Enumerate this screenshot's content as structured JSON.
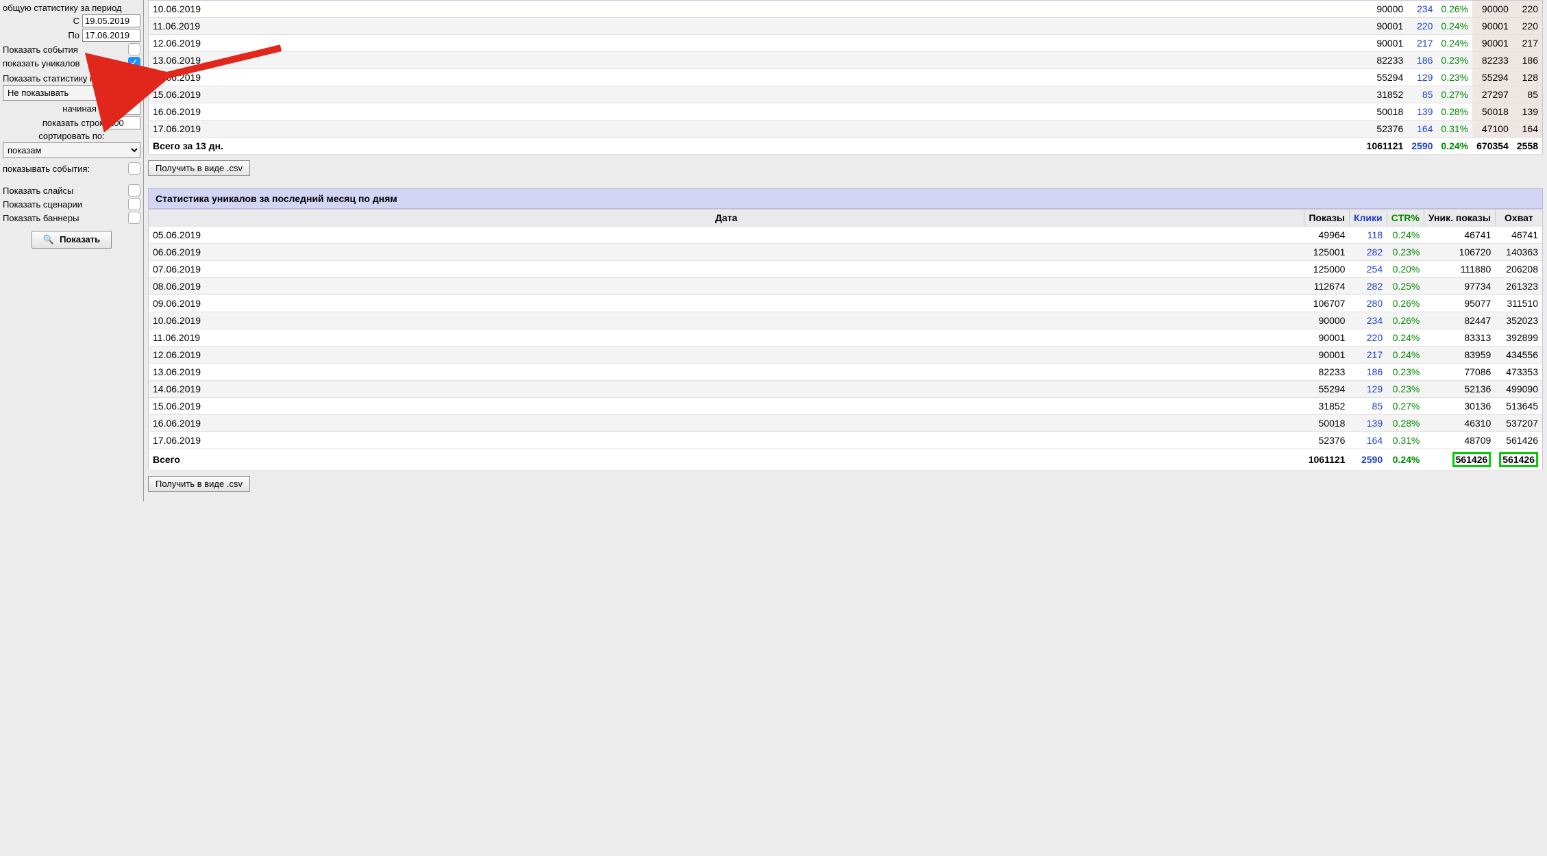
{
  "sidebar": {
    "period_label": "общую статистику за период",
    "from_label": "С",
    "from_value": "19.05.2019",
    "to_label": "По",
    "to_value": "17.06.2019",
    "show_events_label": "Показать события",
    "show_uniques_label": "показать уникалов",
    "sites_heading": "Показать статистику по сайтам:",
    "sites_select": "Не показывать",
    "starting_label": "начиная с",
    "starting_value": "0",
    "rows_label": "показать строк",
    "rows_value": "100",
    "sort_label": "сортировать по:",
    "sort_select": "показам",
    "show_events2_label": "показывать события:",
    "show_slices_label": "Показать слайсы",
    "show_scenarios_label": "Показать сценарии",
    "show_banners_label": "Показать баннеры",
    "show_btn": "Показать"
  },
  "csv_btn": "Получить в виде .csv",
  "table1": {
    "rows": [
      {
        "date": "10.06.2019",
        "shows": "90000",
        "clicks": "234",
        "ctr": "0.26%",
        "u1": "90000",
        "u2": "220"
      },
      {
        "date": "11.06.2019",
        "shows": "90001",
        "clicks": "220",
        "ctr": "0.24%",
        "u1": "90001",
        "u2": "220"
      },
      {
        "date": "12.06.2019",
        "shows": "90001",
        "clicks": "217",
        "ctr": "0.24%",
        "u1": "90001",
        "u2": "217"
      },
      {
        "date": "13.06.2019",
        "shows": "82233",
        "clicks": "186",
        "ctr": "0.23%",
        "u1": "82233",
        "u2": "186"
      },
      {
        "date": "14.06.2019",
        "shows": "55294",
        "clicks": "129",
        "ctr": "0.23%",
        "u1": "55294",
        "u2": "128"
      },
      {
        "date": "15.06.2019",
        "shows": "31852",
        "clicks": "85",
        "ctr": "0.27%",
        "u1": "27297",
        "u2": "85"
      },
      {
        "date": "16.06.2019",
        "shows": "50018",
        "clicks": "139",
        "ctr": "0.28%",
        "u1": "50018",
        "u2": "139"
      },
      {
        "date": "17.06.2019",
        "shows": "52376",
        "clicks": "164",
        "ctr": "0.31%",
        "u1": "47100",
        "u2": "164"
      }
    ],
    "totals": {
      "date": "Всего за 13 дн.",
      "shows": "1061121",
      "clicks": "2590",
      "ctr": "0.24%",
      "u1": "670354",
      "u2": "2558"
    }
  },
  "section2_title": "Статистика уникалов за последний месяц по дням",
  "table2": {
    "headers": {
      "date": "Дата",
      "shows": "Показы",
      "clicks": "Клики",
      "ctr": "CTR%",
      "ushow": "Уник. показы",
      "reach": "Охват"
    },
    "rows": [
      {
        "date": "05.06.2019",
        "shows": "49964",
        "clicks": "118",
        "ctr": "0.24%",
        "ushow": "46741",
        "reach": "46741"
      },
      {
        "date": "06.06.2019",
        "shows": "125001",
        "clicks": "282",
        "ctr": "0.23%",
        "ushow": "106720",
        "reach": "140363"
      },
      {
        "date": "07.06.2019",
        "shows": "125000",
        "clicks": "254",
        "ctr": "0.20%",
        "ushow": "111880",
        "reach": "206208"
      },
      {
        "date": "08.06.2019",
        "shows": "112674",
        "clicks": "282",
        "ctr": "0.25%",
        "ushow": "97734",
        "reach": "261323"
      },
      {
        "date": "09.06.2019",
        "shows": "106707",
        "clicks": "280",
        "ctr": "0.26%",
        "ushow": "95077",
        "reach": "311510"
      },
      {
        "date": "10.06.2019",
        "shows": "90000",
        "clicks": "234",
        "ctr": "0.26%",
        "ushow": "82447",
        "reach": "352023"
      },
      {
        "date": "11.06.2019",
        "shows": "90001",
        "clicks": "220",
        "ctr": "0.24%",
        "ushow": "83313",
        "reach": "392899"
      },
      {
        "date": "12.06.2019",
        "shows": "90001",
        "clicks": "217",
        "ctr": "0.24%",
        "ushow": "83959",
        "reach": "434556"
      },
      {
        "date": "13.06.2019",
        "shows": "82233",
        "clicks": "186",
        "ctr": "0.23%",
        "ushow": "77086",
        "reach": "473353"
      },
      {
        "date": "14.06.2019",
        "shows": "55294",
        "clicks": "129",
        "ctr": "0.23%",
        "ushow": "52136",
        "reach": "499090"
      },
      {
        "date": "15.06.2019",
        "shows": "31852",
        "clicks": "85",
        "ctr": "0.27%",
        "ushow": "30136",
        "reach": "513645"
      },
      {
        "date": "16.06.2019",
        "shows": "50018",
        "clicks": "139",
        "ctr": "0.28%",
        "ushow": "46310",
        "reach": "537207"
      },
      {
        "date": "17.06.2019",
        "shows": "52376",
        "clicks": "164",
        "ctr": "0.31%",
        "ushow": "48709",
        "reach": "561426"
      }
    ],
    "totals": {
      "date": "Всего",
      "shows": "1061121",
      "clicks": "2590",
      "ctr": "0.24%",
      "ushow": "561426",
      "reach": "561426"
    }
  }
}
